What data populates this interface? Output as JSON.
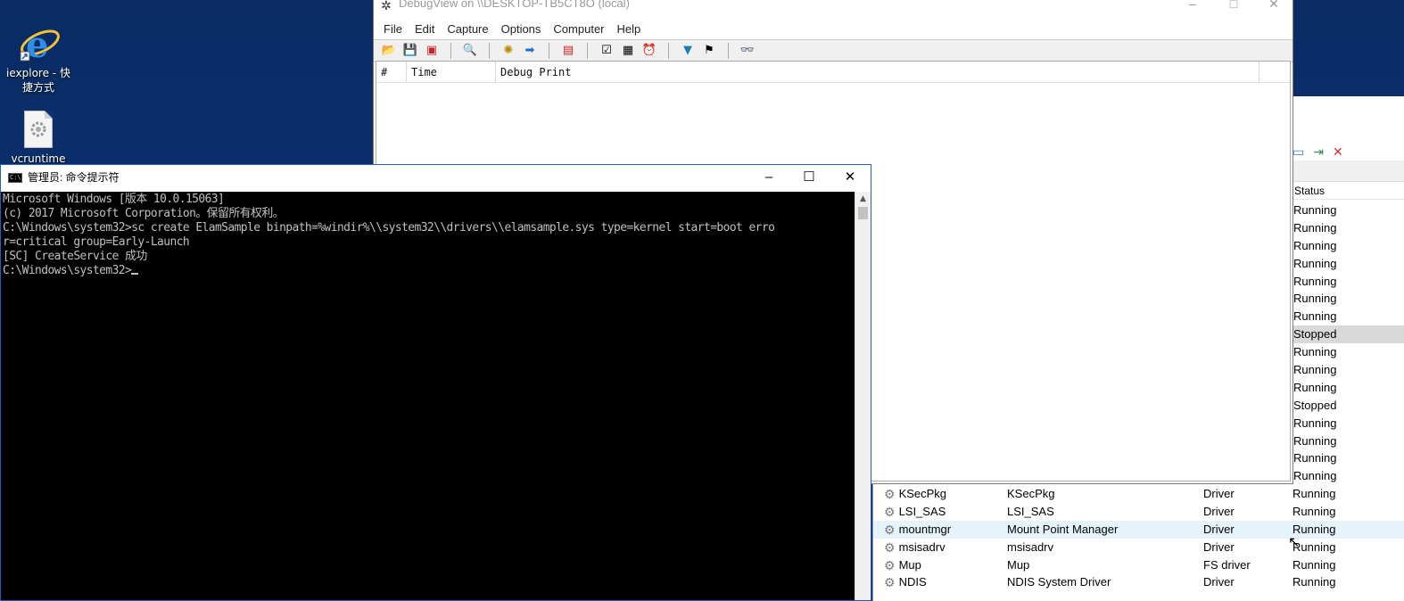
{
  "desktop": {
    "icons": [
      {
        "label": "iexplore - 快\n捷方式"
      },
      {
        "label": "vcruntime"
      }
    ]
  },
  "debugview": {
    "title": "DebugView on \\\\DESKTOP-TB5CT8O (local)",
    "menu": [
      "File",
      "Edit",
      "Capture",
      "Options",
      "Computer",
      "Help"
    ],
    "columns": {
      "num": "#",
      "time": "Time",
      "print": "Debug Print"
    }
  },
  "cmd": {
    "title": "管理员: 命令提示符",
    "lines": [
      "Microsoft Windows [版本 10.0.15063]",
      "(c) 2017 Microsoft Corporation。保留所有权利。",
      "",
      "C:\\Windows\\system32>sc create ElamSample binpath=%windir%\\\\system32\\\\drivers\\\\elamsample.sys type=kernel start=boot erro",
      "r=critical group=Early-Launch",
      "[SC] CreateService 成功",
      "",
      "C:\\Windows\\system32>"
    ]
  },
  "services": {
    "status_header": "Status",
    "status_column": [
      "Running",
      "Running",
      "Running",
      "Running",
      "Running",
      "Running",
      "Running",
      "Stopped",
      "Running",
      "Running",
      "Running",
      "Stopped",
      "Running",
      "Running",
      "Running",
      "Running"
    ],
    "rows": [
      {
        "name": "KSecPkg",
        "desc": "KSecPkg",
        "type": "Driver",
        "status": "Running"
      },
      {
        "name": "LSI_SAS",
        "desc": "LSI_SAS",
        "type": "Driver",
        "status": "Running"
      },
      {
        "name": "mountmgr",
        "desc": "Mount Point Manager",
        "type": "Driver",
        "status": "Running"
      },
      {
        "name": "msisadrv",
        "desc": "msisadrv",
        "type": "Driver",
        "status": "Running"
      },
      {
        "name": "Mup",
        "desc": "Mup",
        "type": "FS driver",
        "status": "Running"
      },
      {
        "name": "NDIS",
        "desc": "NDIS System Driver",
        "type": "Driver",
        "status": "Running"
      }
    ]
  }
}
